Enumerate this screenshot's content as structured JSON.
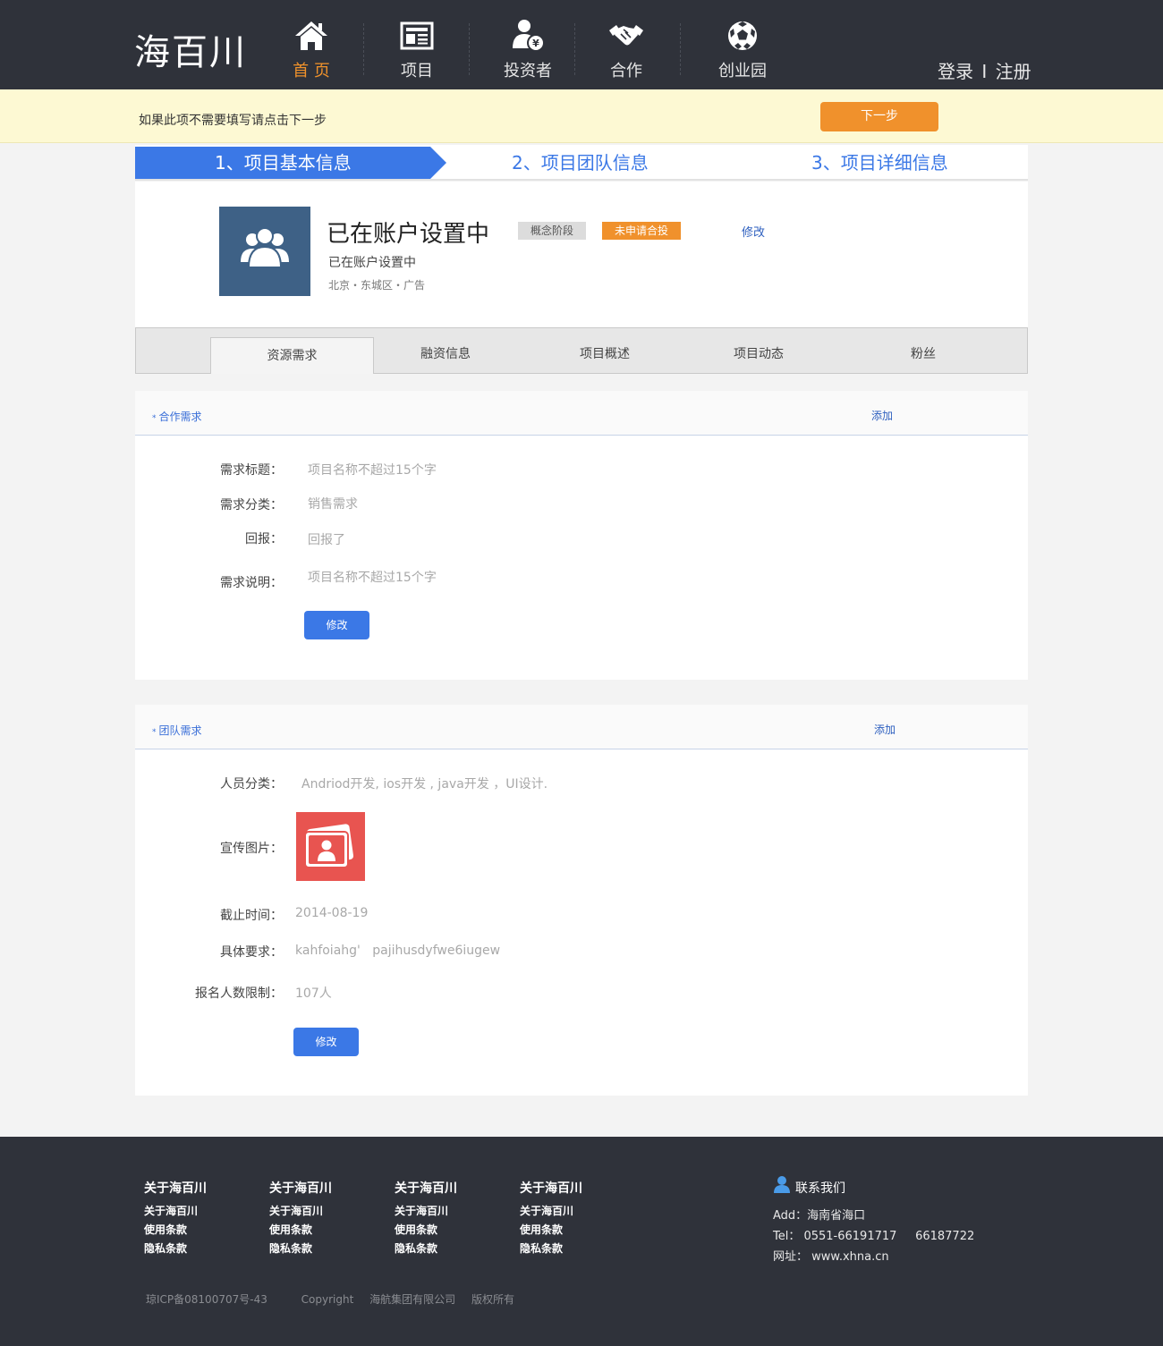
{
  "header": {
    "logo": "海百川",
    "nav": [
      {
        "label": "首 页",
        "icon": "home-icon"
      },
      {
        "label": "项目",
        "icon": "newspaper-icon"
      },
      {
        "label": "投资者",
        "icon": "investor-icon"
      },
      {
        "label": "合作",
        "icon": "handshake-icon"
      },
      {
        "label": "创业园",
        "icon": "football-icon"
      }
    ],
    "login": "登录",
    "separator": "I",
    "register": "注册"
  },
  "notice": {
    "text": "如果此项不需要填写请点击下一步",
    "next_button": "下一步"
  },
  "steps": [
    "1、项目基本信息",
    "2、项目团队信息",
    "3、项目详细信息"
  ],
  "project": {
    "name": "已在账户设置中",
    "badge_stage": "概念阶段",
    "badge_status": "未申请合投",
    "edit": "修改",
    "subtitle": "已在账户设置中",
    "location": "北京・东城区・广告"
  },
  "tabs": [
    "资源需求",
    "融资信息",
    "项目概述",
    "项目动态",
    "粉丝"
  ],
  "cooperation": {
    "title": "合作需求",
    "add": "添加",
    "fields": [
      {
        "label": "需求标题：",
        "value": "项目名称不超过15个字"
      },
      {
        "label": "需求分类：",
        "value": "销售需求"
      },
      {
        "label": "回报：",
        "value": "回报了"
      },
      {
        "label": "需求说明：",
        "value": "项目名称不超过15个字"
      }
    ],
    "button": "修改"
  },
  "team": {
    "title": "团队需求",
    "add": "添加",
    "fields": {
      "role_label": "人员分类：",
      "role_value": "Andriod开发, ios开发 , java开发 ，UI设计.",
      "image_label": "宣传图片：",
      "deadline_label": "截止时间：",
      "deadline_value": "2014-08-19",
      "req_label": "具体要求：",
      "req_value": "kahfoiahg'   pajihusdyfwe6iugew",
      "limit_label": "报名人数限制：",
      "limit_value": "107人"
    },
    "button": "修改"
  },
  "footer": {
    "columns": [
      {
        "title": "关于海百川",
        "items": [
          "关于海百川",
          "使用条款",
          "隐私条款"
        ]
      },
      {
        "title": "关于海百川",
        "items": [
          "关于海百川",
          "使用条款",
          "隐私条款"
        ]
      },
      {
        "title": "关于海百川",
        "items": [
          "关于海百川",
          "使用条款",
          "隐私条款"
        ]
      },
      {
        "title": "关于海百川",
        "items": [
          "关于海百川",
          "使用条款",
          "隐私条款"
        ]
      }
    ],
    "contact_title": "联系我们",
    "contact_lines": [
      "Add：海南省海口",
      "Tel： 0551-66191717     66187722",
      "网址： www.xhna.cn"
    ],
    "icp": "琼ICP备08100707号-43",
    "copyright": "Copyright",
    "company": "海航集团有限公司",
    "rights": "版权所有"
  },
  "colors": {
    "header_bg": "#2f323a",
    "accent_orange": "#f0912c",
    "accent_blue": "#3b78e6",
    "notice_bg": "#fdf9d3"
  }
}
